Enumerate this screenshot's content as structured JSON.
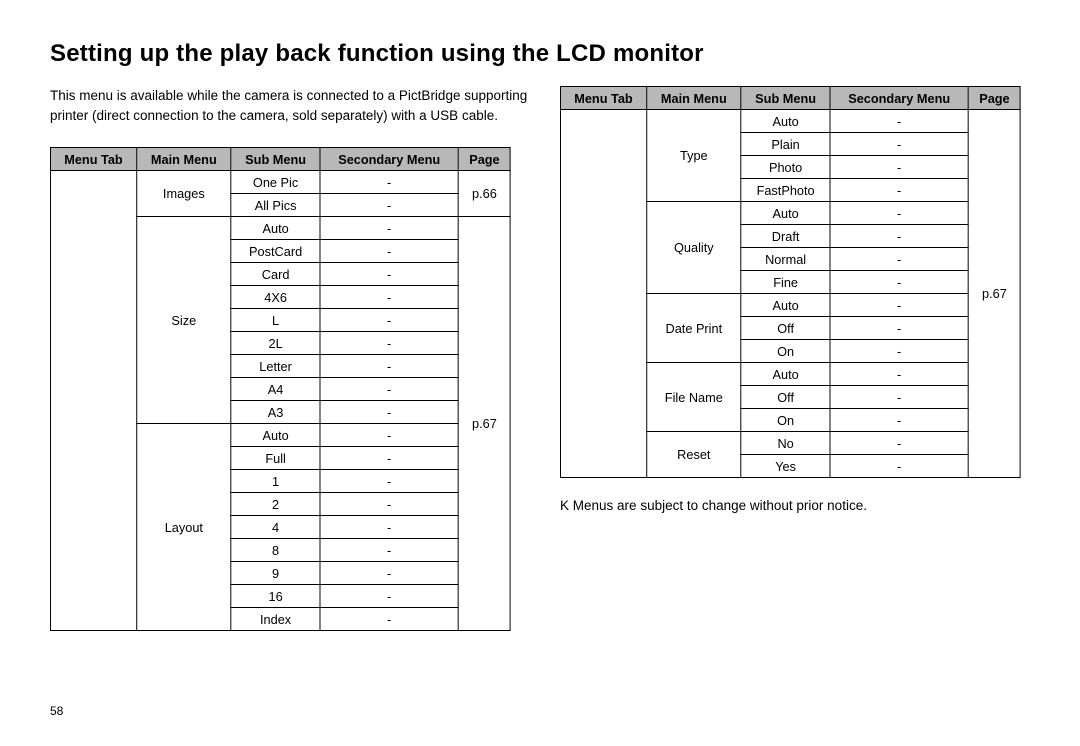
{
  "title": "Setting up the play back function using the LCD monitor",
  "intro": "This menu is available while the camera is connected to a PictBridge supporting printer (direct connection to the camera, sold separately) with a USB cable.",
  "dash": "-",
  "headers": {
    "menuTab": "Menu Tab",
    "mainMenu": "Main Menu",
    "subMenu": "Sub Menu",
    "secondaryMenu": "Secondary Menu",
    "page": "Page"
  },
  "left": {
    "images": {
      "label": "Images",
      "sub": [
        "One Pic",
        "All Pics"
      ],
      "page": "p.66"
    },
    "size": {
      "label": "Size",
      "sub": [
        "Auto",
        "PostCard",
        "Card",
        "4X6",
        "L",
        "2L",
        "Letter",
        "A4",
        "A3"
      ]
    },
    "layout": {
      "label": "Layout",
      "sub": [
        "Auto",
        "Full",
        "1",
        "2",
        "4",
        "8",
        "9",
        "16",
        "Index"
      ]
    },
    "page67": "p.67"
  },
  "right": {
    "type": {
      "label": "Type",
      "sub": [
        "Auto",
        "Plain",
        "Photo",
        "FastPhoto"
      ]
    },
    "quality": {
      "label": "Quality",
      "sub": [
        "Auto",
        "Draft",
        "Normal",
        "Fine"
      ]
    },
    "datePrint": {
      "label": "Date Print",
      "sub": [
        "Auto",
        "Off",
        "On"
      ]
    },
    "fileName": {
      "label": "File Name",
      "sub": [
        "Auto",
        "Off",
        "On"
      ]
    },
    "reset": {
      "label": "Reset",
      "sub": [
        "No",
        "Yes"
      ]
    },
    "page67": "p.67"
  },
  "footnote": "Menus are subject to change without prior notice.",
  "footnoteMarker": "K",
  "pageNumber": "58"
}
